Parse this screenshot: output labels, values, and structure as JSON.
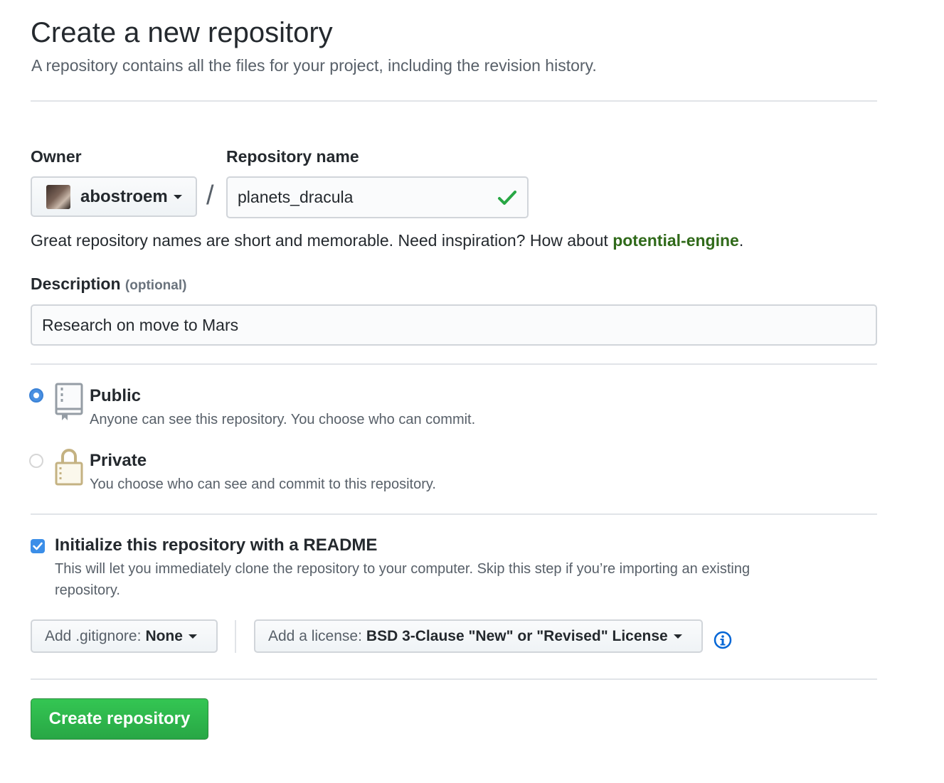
{
  "header": {
    "title": "Create a new repository",
    "subtitle": "A repository contains all the files for your project, including the revision history."
  },
  "owner": {
    "label": "Owner",
    "selected": "abostroem"
  },
  "repo_name": {
    "label": "Repository name",
    "value": "planets_dracula",
    "valid_icon": "check-icon"
  },
  "separator": "/",
  "hint": {
    "text": "Great repository names are short and memorable. Need inspiration? How about ",
    "suggestion": "potential-engine",
    "end": "."
  },
  "description": {
    "label": "Description",
    "optional": "(optional)",
    "value": "Research on move to Mars"
  },
  "visibility": {
    "selected": "public",
    "public": {
      "title": "Public",
      "desc": "Anyone can see this repository. You choose who can commit.",
      "icon": "repo-book-icon"
    },
    "private": {
      "title": "Private",
      "desc": "You choose who can see and commit to this repository.",
      "icon": "lock-icon"
    }
  },
  "readme": {
    "checked": true,
    "title": "Initialize this repository with a README",
    "desc_line1": "This will let you immediately clone the repository to your computer. Skip this step if you’re importing an existing",
    "desc_line2": "repository."
  },
  "gitignore": {
    "prefix": "Add .gitignore:",
    "value": "None"
  },
  "license": {
    "prefix": "Add a license:",
    "value": "BSD 3-Clause \"New\" or \"Revised\" License",
    "info_icon": "info-icon"
  },
  "submit": {
    "label": "Create repository"
  },
  "colors": {
    "primary_button": "#28a745",
    "suggestion": "#306a1a",
    "check": "#28a745",
    "radio_selected": "#4a90e2",
    "info": "#0366d6"
  }
}
